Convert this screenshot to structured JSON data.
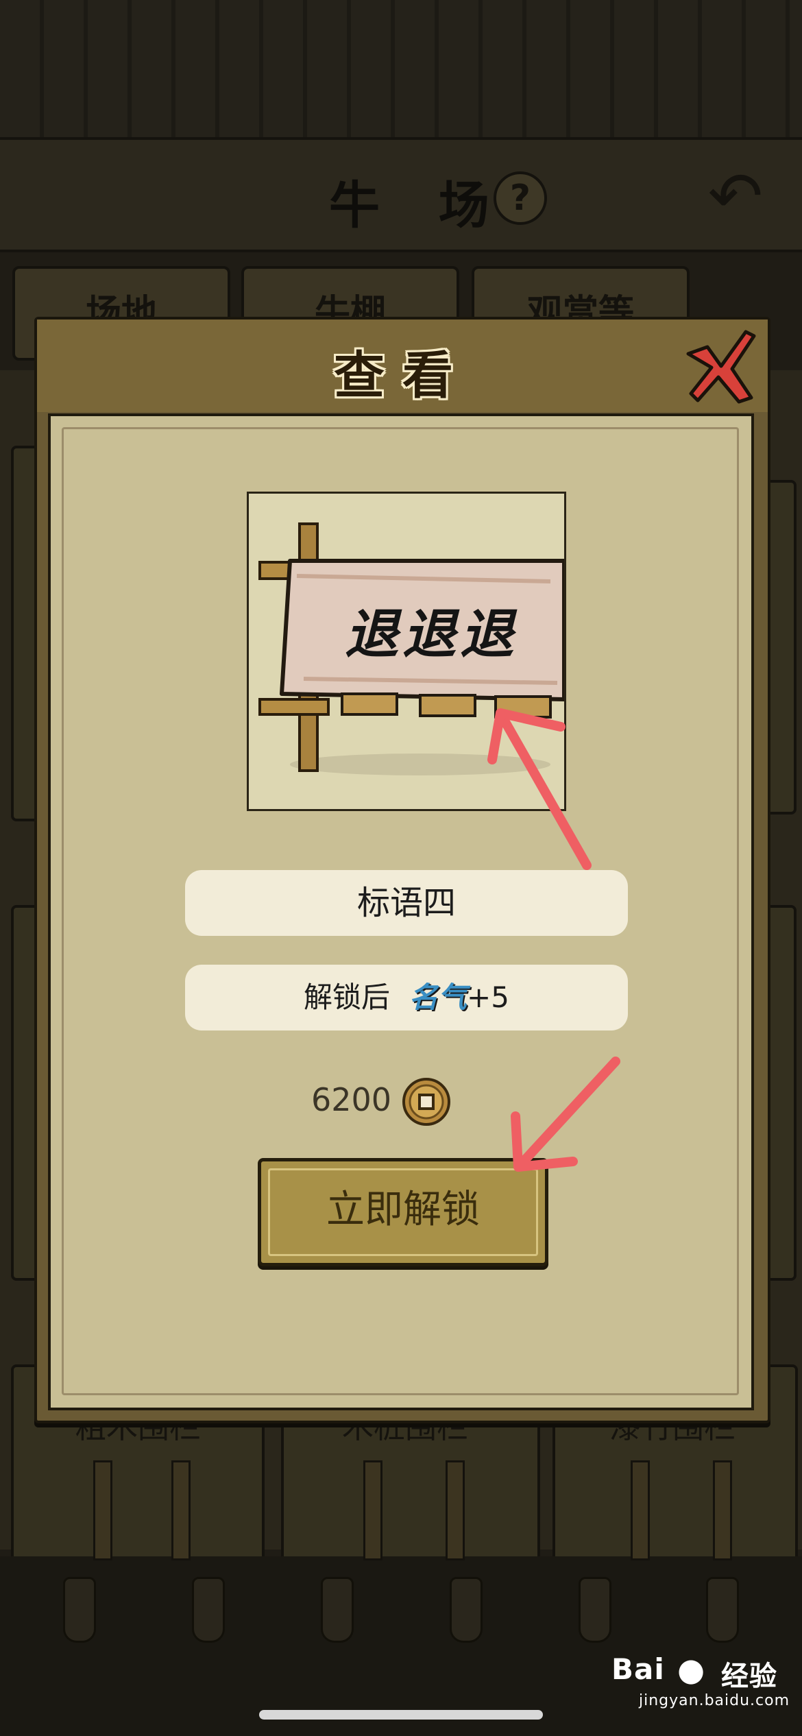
{
  "background": {
    "title": "牛 场",
    "tabs": [
      "场地",
      "牛棚",
      "观赏等"
    ],
    "card_labels": [
      "粗木围栏",
      "木桩围栏",
      "漆竹围栏"
    ]
  },
  "modal": {
    "title": "查看",
    "banner_text": "退退退",
    "item_name": "标语四",
    "unlock_effect": {
      "prefix": "解锁后",
      "stat_name": "名气",
      "stat_bonus": "+5"
    },
    "price": "6200",
    "unlock_button_label": "立即解锁"
  },
  "watermark": {
    "brand": "Bai",
    "brand_cn": "经验",
    "url": "jingyan.baidu.com"
  },
  "colors": {
    "modal_panel": "#c9bf95",
    "pill": "#f2ecd8",
    "button": "#a89148",
    "annotation_arrow": "#ef5f63"
  }
}
